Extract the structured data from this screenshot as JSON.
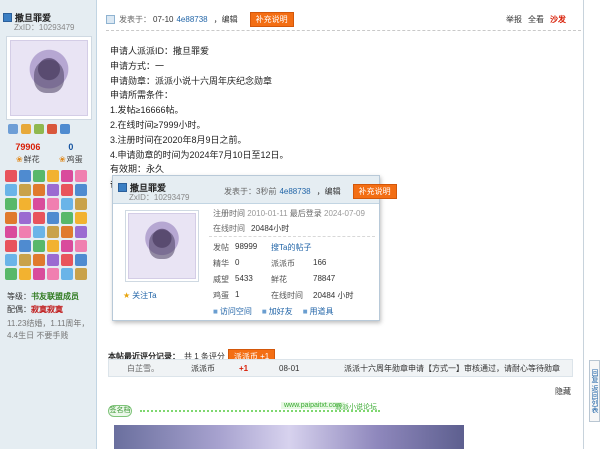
{
  "author": {
    "name": "撒旦罪爱",
    "zxid": "ZxID：10293479",
    "stats": [
      {
        "value": "79906",
        "label": "鲜花"
      },
      {
        "value": "0",
        "label": "鸡蛋"
      }
    ],
    "level_label": "等级：",
    "level_value": "书友联盟成员",
    "title_label": "配偶：",
    "title_value": "寂寞寂寞",
    "signature_note": "11.23结婚，1.11周年，4.4生日 不要手贱"
  },
  "post": {
    "header": {
      "posted_label": "发表于：",
      "date": "07-10",
      "ip": "4e88738",
      "edit": "，编辑",
      "supplement": "补充说明",
      "report": "举报",
      "view_all": "全看",
      "sofa": "沙发"
    },
    "body_lines": [
      "申请人派派ID：撒旦罪爱",
      "申请方式：一",
      "申请勋章：派派小说十六周年庆纪念勋章",
      "申请所需条件：",
      "1.发帖≥16666帖。",
      "2.在线时间≥7999小时。",
      "3.注册时间在2020年8月9日之前。",
      "4.申请勋章的时间为2024年7月10日至12日。",
      "有效期：永久",
      "备注：相关资料截图。"
    ]
  },
  "card": {
    "name": "撒旦罪爱",
    "zxid": "ZxID：10293479",
    "posted_label": "发表于：3秒前",
    "ip": "4e88738",
    "edit": "，编辑",
    "supplement": "补充说明",
    "reg_label": "注册时间",
    "reg_value": "2010-01-11",
    "last_label": "最后登录",
    "last_value": "2024-07-09",
    "online_label": "在线时间",
    "online_value": "20484小时",
    "follow": "关注Ta",
    "grid": [
      {
        "k": "发帖",
        "v": "98999",
        "link": "搜Ta的帖子"
      },
      {
        "k": "精华",
        "v": "0",
        "k2": "派派币",
        "v2": "166"
      },
      {
        "k": "威望",
        "v": "5433",
        "k2": "鲜花",
        "v2": "78847"
      },
      {
        "k": "鸡蛋",
        "v": "1",
        "k2": "在线时间",
        "v2": "20484 小时"
      }
    ],
    "actions": [
      "访问空间",
      "加好友",
      "用道具"
    ]
  },
  "rating": {
    "title": "本帖最近评分记录：",
    "count": "共 1 条评分",
    "badge": "派派币 +1",
    "row": {
      "user": "白芷雪。",
      "type": "派派币",
      "score": "+1",
      "date": "08-01",
      "reason": "派派十六周年勋章申请【方式一】审核通过，请耐心等待勋章"
    }
  },
  "hide_label": "隐藏",
  "signature": {
    "badge": "签名档",
    "url": "www.paipaitxt.com",
    "text": "派派小说论坛"
  },
  "right_tab": "回复 返回列表"
}
